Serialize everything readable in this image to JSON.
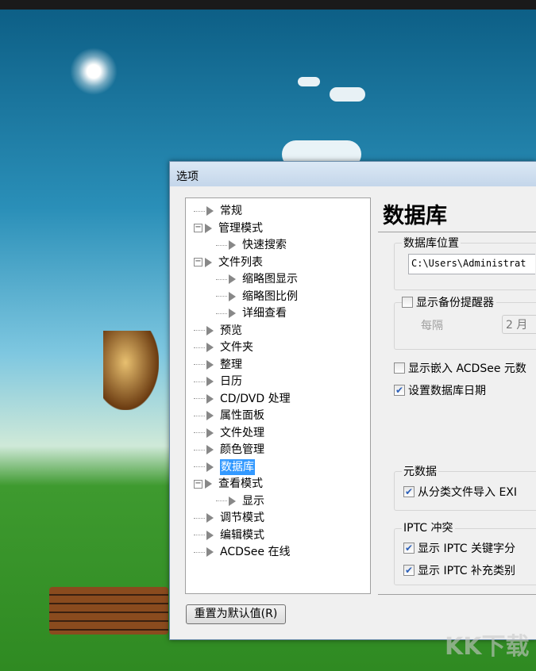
{
  "dialog": {
    "title": "选项",
    "reset_label": "重置为默认值(R)"
  },
  "tree": [
    {
      "label": "常规",
      "level": 0,
      "exp": ""
    },
    {
      "label": "管理模式",
      "level": 0,
      "exp": "−"
    },
    {
      "label": "快速搜索",
      "level": 1,
      "exp": ""
    },
    {
      "label": "文件列表",
      "level": 0,
      "exp": "−"
    },
    {
      "label": "缩略图显示",
      "level": 1,
      "exp": ""
    },
    {
      "label": "缩略图比例",
      "level": 1,
      "exp": ""
    },
    {
      "label": "详细查看",
      "level": 1,
      "exp": ""
    },
    {
      "label": "预览",
      "level": 0,
      "exp": ""
    },
    {
      "label": "文件夹",
      "level": 0,
      "exp": ""
    },
    {
      "label": "整理",
      "level": 0,
      "exp": ""
    },
    {
      "label": "日历",
      "level": 0,
      "exp": ""
    },
    {
      "label": "CD/DVD 处理",
      "level": 0,
      "exp": ""
    },
    {
      "label": "属性面板",
      "level": 0,
      "exp": ""
    },
    {
      "label": "文件处理",
      "level": 0,
      "exp": ""
    },
    {
      "label": "颜色管理",
      "level": 0,
      "exp": ""
    },
    {
      "label": "数据库",
      "level": 0,
      "exp": "",
      "selected": true
    },
    {
      "label": "查看模式",
      "level": 0,
      "exp": "−"
    },
    {
      "label": "显示",
      "level": 1,
      "exp": ""
    },
    {
      "label": "调节模式",
      "level": 0,
      "exp": ""
    },
    {
      "label": "编辑模式",
      "level": 0,
      "exp": ""
    },
    {
      "label": "ACDSee 在线",
      "level": 0,
      "exp": ""
    }
  ],
  "panel": {
    "heading": "数据库",
    "db_location_label": "数据库位置",
    "db_path": "C:\\Users\\Administrat",
    "backup_reminder": {
      "label": "显示备份提醒器",
      "checked": false,
      "every_label": "每隔",
      "interval": "2 月"
    },
    "show_embedded": {
      "label": "显示嵌入 ACDSee 元数",
      "checked": false
    },
    "set_db_date": {
      "label": "设置数据库日期",
      "checked": true
    },
    "metadata_label": "元数据",
    "import_exif": {
      "label": "从分类文件导入 EXI",
      "checked": true
    },
    "iptc_label": "IPTC 冲突",
    "iptc_keywords": {
      "label": "显示 IPTC 关键字分",
      "checked": true
    },
    "iptc_categories": {
      "label": "显示 IPTC 补充类别",
      "checked": true
    }
  },
  "watermark": "KK下载"
}
